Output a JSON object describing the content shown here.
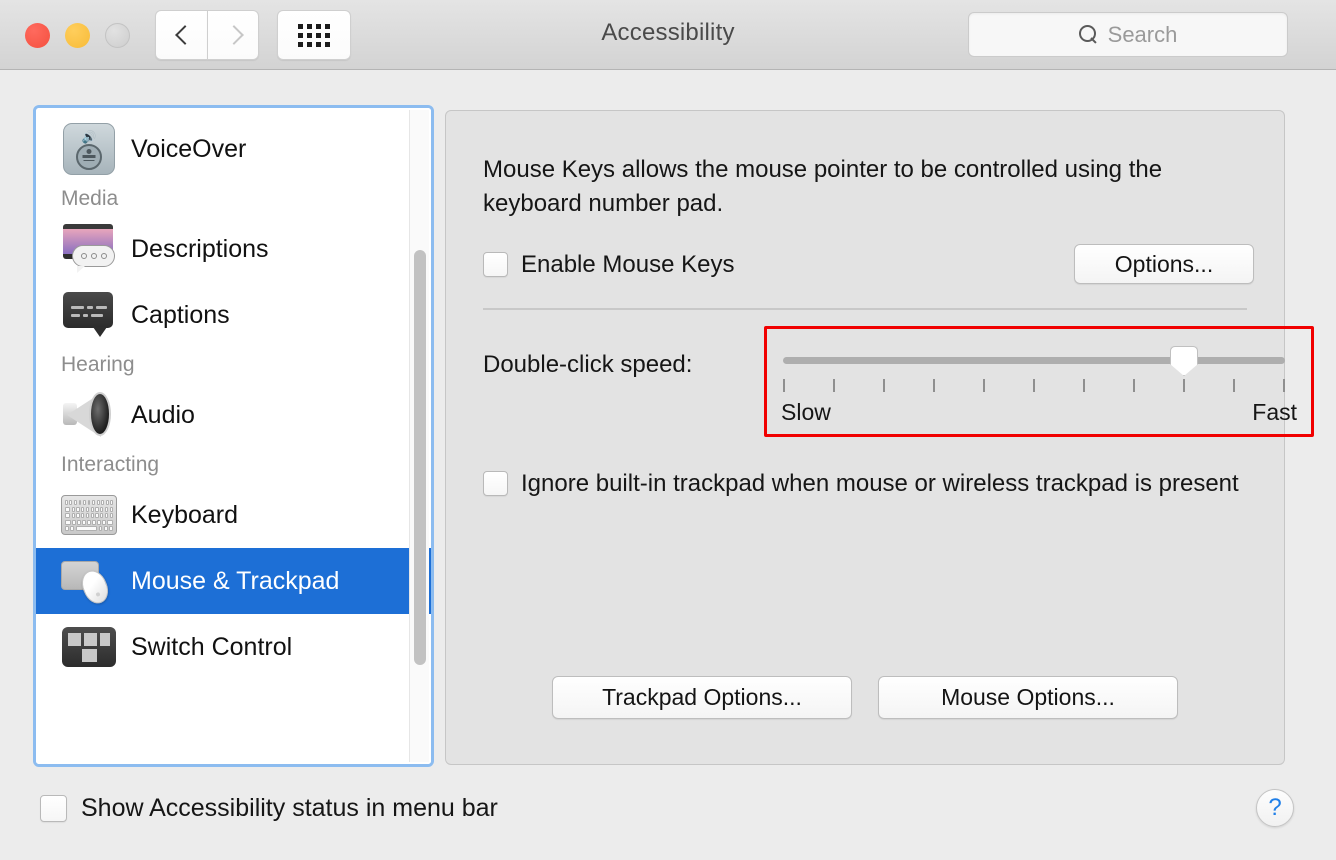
{
  "window": {
    "title": "Accessibility",
    "traffic_lights": [
      "close",
      "minimize",
      "zoom"
    ]
  },
  "toolbar": {
    "back_icon": "chevron-left-icon",
    "forward_icon": "chevron-right-icon",
    "grid_icon": "show-all-grid-icon",
    "search": {
      "placeholder": "Search",
      "value": "",
      "icon": "search-icon"
    }
  },
  "sidebar": {
    "scrollbar": {
      "visible": true
    },
    "items": [
      {
        "type": "item",
        "label": "VoiceOver",
        "icon": "voiceover-icon",
        "selected": false
      },
      {
        "type": "group",
        "label": "Media"
      },
      {
        "type": "item",
        "label": "Descriptions",
        "icon": "descriptions-icon",
        "selected": false
      },
      {
        "type": "item",
        "label": "Captions",
        "icon": "captions-icon",
        "selected": false
      },
      {
        "type": "group",
        "label": "Hearing"
      },
      {
        "type": "item",
        "label": "Audio",
        "icon": "audio-speaker-icon",
        "selected": false
      },
      {
        "type": "group",
        "label": "Interacting"
      },
      {
        "type": "item",
        "label": "Keyboard",
        "icon": "keyboard-icon",
        "selected": false
      },
      {
        "type": "item",
        "label": "Mouse & Trackpad",
        "icon": "mouse-trackpad-icon",
        "selected": true
      },
      {
        "type": "item",
        "label": "Switch Control",
        "icon": "switch-control-icon",
        "selected": false
      }
    ]
  },
  "main": {
    "description": "Mouse Keys allows the mouse pointer to be controlled using the keyboard number pad.",
    "enable_mouse_keys": {
      "label": "Enable Mouse Keys",
      "checked": false
    },
    "options_button": "Options...",
    "double_click_speed": {
      "label": "Double-click speed:",
      "slow_label": "Slow",
      "fast_label": "Fast",
      "tick_count": 11,
      "value_index": 8,
      "value_percent": 80,
      "highlight_color": "#f10000",
      "highlighted": true
    },
    "ignore_trackpad": {
      "label": "Ignore built-in trackpad when mouse or wireless trackpad is present",
      "checked": false
    },
    "trackpad_options_button": "Trackpad Options...",
    "mouse_options_button": "Mouse Options..."
  },
  "footer": {
    "show_status": {
      "label": "Show Accessibility status in menu bar",
      "checked": false
    },
    "help_button": "?"
  },
  "colors": {
    "selection_blue": "#1d6fd6",
    "focus_ring": "#8cbcf0",
    "annotation_red": "#f10000",
    "help_blue": "#1f7fe8"
  }
}
